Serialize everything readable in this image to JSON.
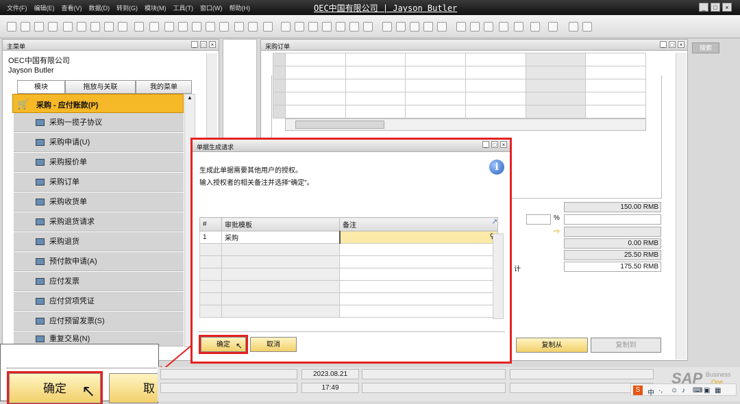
{
  "window": {
    "title": "OEC中国有限公司  |  Jayson Butler",
    "menu": [
      "文件(F)",
      "编辑(E)",
      "查看(V)",
      "数据(D)",
      "转到(G)",
      "模块(M)",
      "工具(T)",
      "窗口(W)",
      "帮助(H)"
    ]
  },
  "main_menu": {
    "title": "主菜单",
    "company": "OEC中国有限公司",
    "user": "Jayson Butler",
    "tabs": [
      "模块",
      "拖放与关联",
      "我的菜单"
    ],
    "section": "采购 - 应付账款(P)",
    "items": [
      "采购一揽子协议",
      "采购申请(U)",
      "采购报价单",
      "采购订单",
      "采购收货单",
      "采购退货请求",
      "采购退货",
      "预付款申请(A)",
      "应付发票",
      "应付贷项凭证",
      "应付预留发票(S)",
      "重复交易(N)"
    ]
  },
  "search_button": "搜索",
  "po_window": {
    "title": "采购订单",
    "totals": {
      "before_discount": "150.00 RMB",
      "freight": "0.00 RMB",
      "tax": "25.50 RMB",
      "total_label": "计",
      "total": "175.50 RMB"
    },
    "percent_sign": "%",
    "copy_from": "复制从",
    "copy_to": "复制到"
  },
  "dialog": {
    "title": "单据生成请求",
    "message_line1": "生成此单据需要其他用户的授权。",
    "message_line2": "输入授权者的相关备注并选择“确定”。",
    "columns": [
      "#",
      "审批模板",
      "备注"
    ],
    "rows": [
      {
        "num": "1",
        "template": "采购",
        "remark": ""
      }
    ],
    "ok": "确定",
    "cancel": "取消"
  },
  "zoom": {
    "ok": "确定",
    "cancel_partial": "取"
  },
  "status_bar": {
    "date": "2023.08.21",
    "time": "17:49",
    "sap_logo": "SAP",
    "business_one_line1": "Business",
    "business_one_line2": "One"
  },
  "colors": {
    "accent_yellow": "#f5c542",
    "highlight_red": "#e42222"
  }
}
